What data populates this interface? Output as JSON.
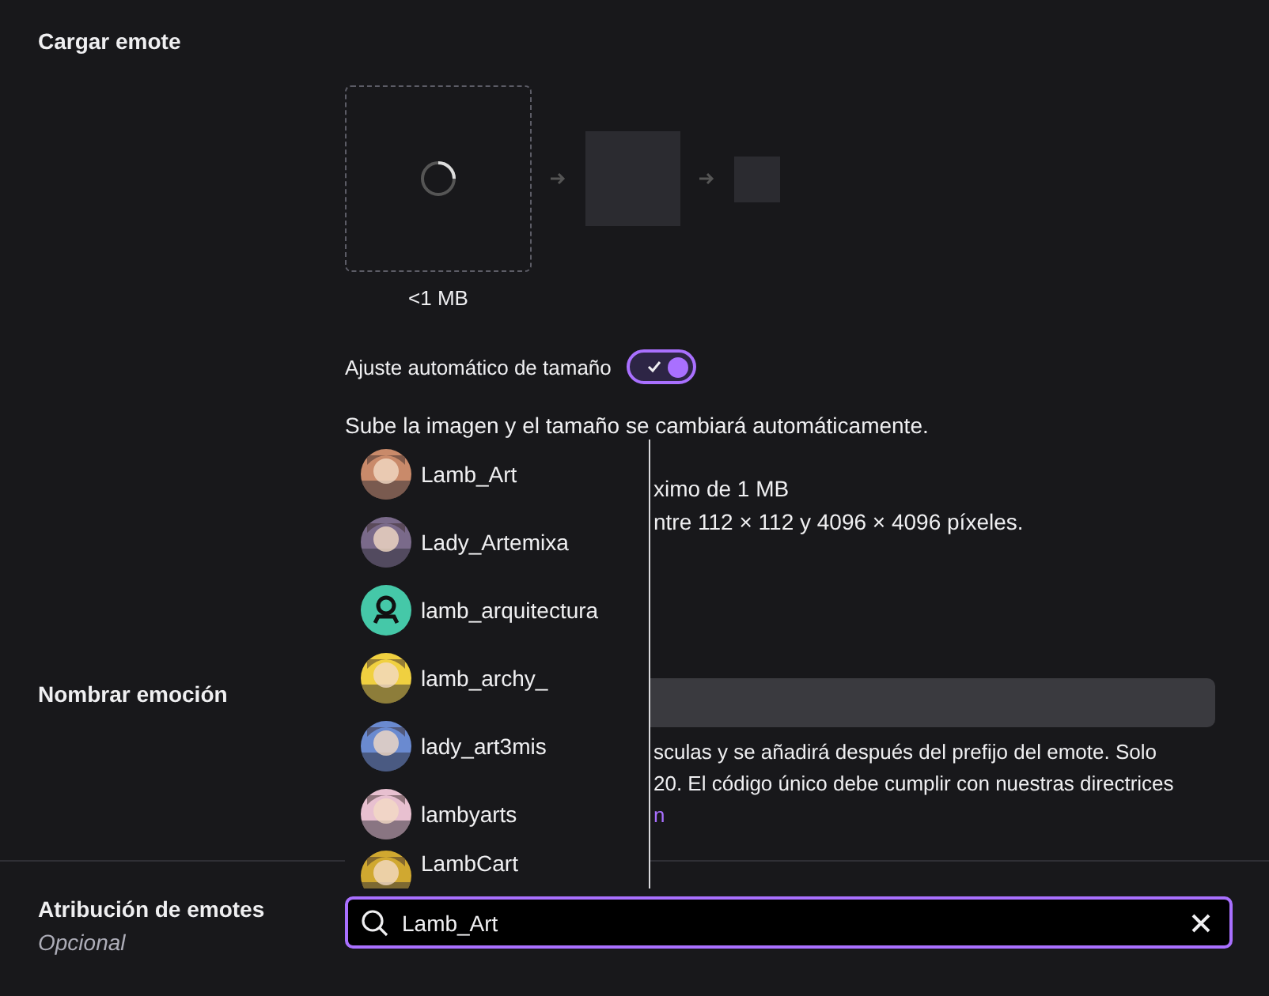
{
  "upload_section": {
    "title": "Cargar emote",
    "size_limit": "<1 MB",
    "auto_resize": {
      "label": "Ajuste automático de tamaño",
      "on": true
    },
    "description": "Sube la imagen y el tamaño se cambiará automáticamente.",
    "hints": [
      "ximo de 1 MB",
      "ntre 112 × 112 y 4096 × 4096 píxeles."
    ]
  },
  "name_section": {
    "title": "Nombrar emoción",
    "help_lines": [
      "sculas y se añadirá después del prefijo del emote. Solo",
      "20. El código único debe cumplir con nuestras directrices"
    ],
    "help_link": "n"
  },
  "attribution_section": {
    "title": "Atribución de emotes",
    "subtitle": "Opcional",
    "search": {
      "value": "Lamb_Art"
    }
  },
  "suggestions": [
    {
      "name": "Lamb_Art",
      "kind": "picture",
      "color": "#c98a6a"
    },
    {
      "name": "Lady_Artemixa",
      "kind": "picture",
      "color": "#7a6a8a"
    },
    {
      "name": "lamb_arquitectura",
      "kind": "default",
      "color": "#45c8a8"
    },
    {
      "name": "lamb_archy_",
      "kind": "picture",
      "color": "#f0d040"
    },
    {
      "name": "lady_art3mis",
      "kind": "picture",
      "color": "#6a8ad0"
    },
    {
      "name": "lambyarts",
      "kind": "picture",
      "color": "#e8c0d0"
    },
    {
      "name": "LambCart",
      "kind": "picture",
      "color": "#d0a830"
    }
  ]
}
